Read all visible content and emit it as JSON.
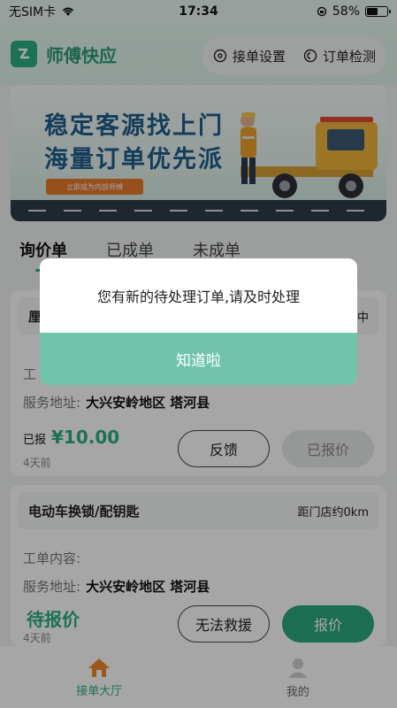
{
  "status_bar": {
    "carrier": "无SIM卡",
    "time": "17:34",
    "battery_level": "58%",
    "battery_fill_percent": 58
  },
  "header": {
    "app_title": "师傅快应",
    "order_settings": "接单设置",
    "order_check": "订单检测"
  },
  "banner": {
    "line1": "稳定客源找上门",
    "line2": "海量订单优先派",
    "button_label": "立即成为内部师傅"
  },
  "tabs": [
    {
      "label": "询价单",
      "active": true
    },
    {
      "label": "已成单",
      "active": false
    },
    {
      "label": "未成单",
      "active": false
    }
  ],
  "orders": [
    {
      "title_visible": "厘",
      "distance_visible": "中",
      "work_content_label": "工",
      "service_address_label": "服务地址:",
      "service_address": "大兴安岭地区 塔河县",
      "quoted_label": "已报",
      "price": "¥10.00",
      "time_ago": "4天前",
      "btn_feedback": "反馈",
      "btn_quoted": "已报价"
    },
    {
      "title": "电动车换锁/配钥匙",
      "distance": "距门店约0km",
      "work_content_label": "工单内容:",
      "service_address_label": "服务地址:",
      "service_address": "大兴安岭地区 塔河县",
      "status": "待报价",
      "time_ago": "4天前",
      "btn_cannot": "无法救援",
      "btn_quote": "报价"
    }
  ],
  "tabbar": {
    "home": "接单大厅",
    "mine": "我的"
  },
  "modal": {
    "message": "您有新的待处理订单,请及时处理",
    "confirm": "知道啦"
  },
  "colors": {
    "accent": "#2cae86",
    "modal_button": "#6fc4ab",
    "banner_text": "#1f5f8c"
  }
}
